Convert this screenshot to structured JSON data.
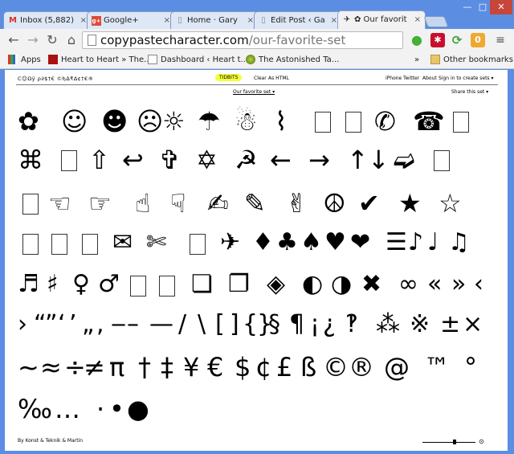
{
  "browser": {
    "tabs": [
      {
        "label": "Inbox (5,882)",
        "icon": "gmail-icon",
        "icon_glyph": "M",
        "icon_color": "#d93025"
      },
      {
        "label": "Google+",
        "icon": "googleplus-icon",
        "icon_glyph": "g+",
        "icon_color": "#dd4b39"
      },
      {
        "label": "Home · Gary",
        "icon": "page-icon",
        "icon_glyph": "▯",
        "icon_color": "#888888"
      },
      {
        "label": "Edit Post ‹ Ga",
        "icon": "page-icon",
        "icon_glyph": "▯",
        "icon_color": "#888888"
      },
      {
        "label": "✿ Our favorit",
        "icon": "airplane-icon",
        "icon_glyph": "✈",
        "icon_color": "#000000"
      }
    ],
    "tab_close": "×",
    "window_controls": {
      "minimize": "—",
      "restore": "□",
      "close": "✕"
    },
    "nav": {
      "back": "←",
      "forward": "→",
      "reload": "↻",
      "home": "⌂"
    },
    "url_host": "copypastecharacter.com",
    "url_path": "/our-favorite-set",
    "bookmark_star": "☆",
    "extensions": [
      {
        "name": "green-dot-extension-icon",
        "color": "#44b035",
        "glyph": "●"
      },
      {
        "name": "red-star-extension-icon",
        "color": "#c8102e",
        "glyph": "✱"
      },
      {
        "name": "sync-extension-icon",
        "color": "#3ea43e",
        "glyph": "⟳"
      },
      {
        "name": "zero-badge-extension-icon",
        "color": "#f0a830",
        "glyph": "0"
      }
    ],
    "menu": "≡",
    "bookmarks": [
      {
        "label": "Apps"
      },
      {
        "label": "Heart to Heart » The..."
      },
      {
        "label": "Dashboard ‹ Heart t..."
      },
      {
        "label": "The Astonished Ta..."
      }
    ],
    "bookmarks_more": "»",
    "other_bookmarks": "Other bookmarks"
  },
  "site": {
    "logo": "C☺Ωÿ ρ∂$†€ ©ђ∆₹∆¢†€®",
    "tidbits": "TIDBITS",
    "nav_left": [
      "Clear",
      "As HTML"
    ],
    "nav_right": [
      "iPhone",
      "Twitter",
      "About",
      "Sign in to create sets ▾"
    ],
    "set_select": "Our favorite set ▾",
    "share": "Share this set ▾",
    "footer": "By Konst & Teknik & Martin",
    "zoom_icon": "⊙"
  },
  "characters": {
    "row1": [
      "✿",
      "☺",
      "☻",
      "☹",
      "☼",
      "☂",
      "☃",
      "⌇",
      "",
      "",
      "✆",
      "☎",
      ""
    ],
    "row2": [
      "⌘",
      "",
      "⇧",
      "↩",
      "✞",
      "✡",
      "☭",
      "←",
      "→",
      "↑",
      "↓",
      "➫",
      ""
    ],
    "row3": [
      "",
      "☜",
      "☞",
      "☝",
      "☟",
      "✍",
      "✎",
      "✌",
      "☮",
      "✔",
      "★",
      "☆"
    ],
    "row4": [
      "",
      "",
      "",
      "✉",
      "✄",
      "",
      "✈",
      "♦",
      "♣",
      "♠",
      "♥",
      "❤",
      "☰",
      "♪",
      "♩",
      "♫"
    ],
    "row5": [
      "♬",
      "♯",
      "♀",
      "♂",
      "",
      "",
      "❏",
      "❐",
      "◈",
      "◐",
      "◑",
      "✖",
      "∞",
      "«",
      "»",
      "‹"
    ],
    "row6": [
      "›",
      "“",
      "”",
      "‘",
      "’",
      "„",
      ",",
      "‒",
      "–",
      "—",
      "/",
      "\\",
      "[",
      "]",
      "{",
      "}",
      "§",
      "¶",
      "¡",
      "¿",
      "‽",
      "⁂",
      "※",
      "±",
      "×"
    ],
    "row7": [
      "~",
      "≈",
      "÷",
      "≠",
      "π",
      "†",
      "‡",
      "¥",
      "€",
      "$",
      "¢",
      "£",
      "ß",
      "©",
      "®",
      "@",
      "™",
      "°"
    ],
    "row8": [
      "‰",
      "…",
      "·",
      "•",
      "●"
    ]
  }
}
